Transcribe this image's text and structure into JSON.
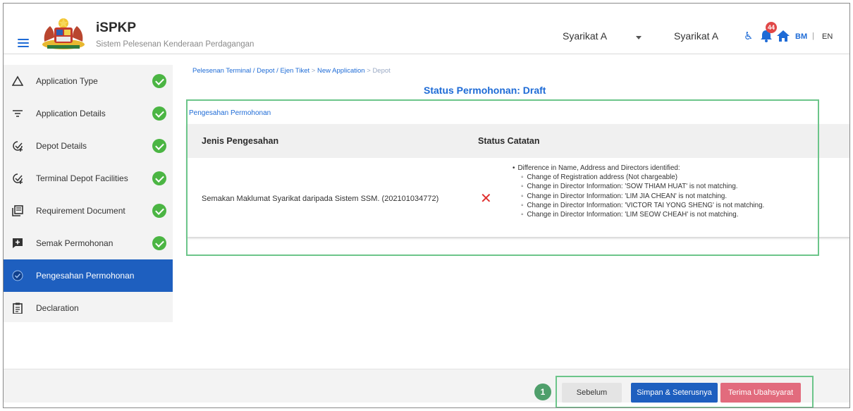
{
  "header": {
    "app_name": "iSPKP",
    "app_subtitle": "Sistem Pelesenan Kenderaan Perdagangan",
    "company_select": "Syarikat A",
    "company_name": "Syarikat A",
    "notification_count": "44",
    "lang_bm": "BM",
    "lang_sep": "|",
    "lang_en": "EN"
  },
  "sidebar": {
    "items": [
      {
        "label": "Application Type",
        "icon": "triangle-icon",
        "done": true
      },
      {
        "label": "Application Details",
        "icon": "filter-icon",
        "done": true
      },
      {
        "label": "Depot Details",
        "icon": "check-plus-icon",
        "done": true
      },
      {
        "label": "Terminal Depot Facilities",
        "icon": "check-plus-icon",
        "done": true
      },
      {
        "label": "Requirement Document",
        "icon": "document-stack-icon",
        "done": true
      },
      {
        "label": "Semak Permohonan",
        "icon": "review-icon",
        "done": true
      },
      {
        "label": "Pengesahan Permohonan",
        "icon": "verify-icon",
        "active": true
      },
      {
        "label": "Declaration",
        "icon": "clipboard-icon"
      }
    ]
  },
  "breadcrumb": {
    "part1": "Pelesenan Terminal / Depot / Ejen Tiket",
    "sep1": " > ",
    "part2": "New Application",
    "sep2": " > ",
    "current": "Depot"
  },
  "main": {
    "status_title": "Status Permohonan: Draft",
    "panel_label": "Pengesahan Permohonan",
    "table": {
      "col1": "Jenis Pengesahan",
      "col2": "Status Catatan",
      "row": {
        "type": "Semakan Maklumat Syarikat daripada Sistem SSM. (202101034772)",
        "status_icon": "x-icon",
        "notes_main": "Difference in Name, Address and Directors identified:",
        "notes": [
          "Change of Registration address (Not chargeable)",
          "Change in Director Information: 'SOW THIAM HUAT' is not matching.",
          "Change in Director Information: 'LIM JIA CHEAN' is not matching.",
          "Change in Director Information: 'VICTOR TAI YONG SHENG' is not matching.",
          "Change in Director Information: 'LIM SEOW CHEAH' is not matching."
        ]
      }
    }
  },
  "footer": {
    "step_number": "1",
    "prev_label": "Sebelum",
    "save_label": "Simpan & Seterusnya",
    "accept_label": "Terima Ubahsyarat"
  },
  "colors": {
    "primary": "#1e5fbf",
    "link": "#1e6bd6",
    "success": "#4bb543",
    "highlight": "#6cc58a",
    "danger": "#e0302f",
    "accept_button": "#e26b7d"
  }
}
